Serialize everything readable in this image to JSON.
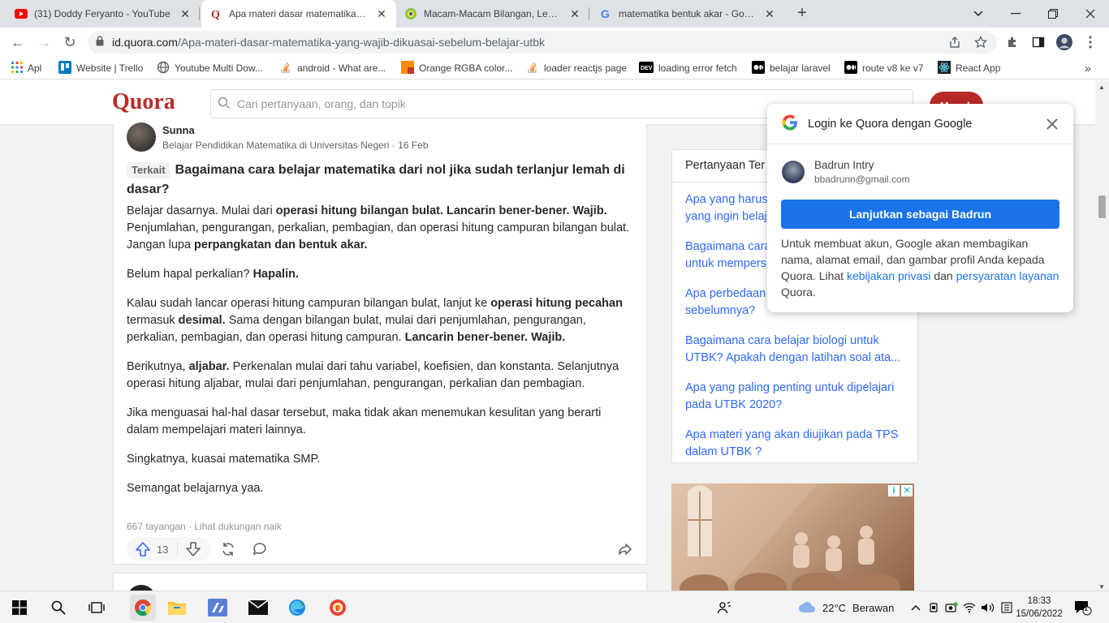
{
  "tabs": [
    {
      "title": "(31) Doddy Feryanto - YouTube",
      "icon": "youtube-icon"
    },
    {
      "title": "Apa materi dasar matematika yang wajib dikuasai",
      "icon": "quora-icon"
    },
    {
      "title": "Macam-Macam Bilangan, Lengkap",
      "icon": "site-icon"
    },
    {
      "title": "matematika bentuk akar - Google",
      "icon": "google-icon"
    }
  ],
  "omnibox": {
    "host": "id.quora.com",
    "path": "/Apa-materi-dasar-matematika-yang-wajib-dikuasai-sebelum-belajar-utbk"
  },
  "bookmarks": [
    {
      "label": "Apl",
      "icon": "apps-grid-icon"
    },
    {
      "label": "Website | Trello",
      "icon": "trello-icon"
    },
    {
      "label": "Youtube Multi Dow...",
      "icon": "globe-icon"
    },
    {
      "label": "android - What are...",
      "icon": "stackoverflow-icon"
    },
    {
      "label": "Orange RGBA color...",
      "icon": "color-icon"
    },
    {
      "label": "loader reactjs page",
      "icon": "stackoverflow-icon"
    },
    {
      "label": "loading error fetch",
      "icon": "dev-icon"
    },
    {
      "label": "belajar laravel",
      "icon": "medium-icon"
    },
    {
      "label": "route v8 ke v7",
      "icon": "medium-icon"
    },
    {
      "label": "React App",
      "icon": "react-icon"
    }
  ],
  "quora": {
    "logo": "Quora",
    "search_placeholder": "Cari pertanyaan, orang, dan topik",
    "signin_label": "Masuk"
  },
  "answer": {
    "author": "Sunna",
    "credential": "Belajar Pendidikan Matematika di Universitas Negeri · 16 Feb",
    "related_tag": "Terkait",
    "related_question": "Bagaimana cara belajar matematika dari nol jika sudah terlanjur lemah di dasar?",
    "views": "667 tayangan · Lihat dukungan naik",
    "upvotes": "13"
  },
  "answer_paragraphs": [
    [
      {
        "t": "Belajar dasarnya. Mulai dari "
      },
      {
        "t": "operasi hitung bilangan bulat. Lancarin bener-bener. Wajib.",
        "b": true
      },
      {
        "t": " Penjumlahan, pengurangan, perkalian, pembagian, dan operasi hitung campuran bilangan bulat. Jangan lupa "
      },
      {
        "t": "perpangkatan dan bentuk akar.",
        "b": true
      }
    ],
    [
      {
        "t": "Belum hapal perkalian? "
      },
      {
        "t": "Hapalin.",
        "b": true
      }
    ],
    [
      {
        "t": "Kalau sudah lancar operasi hitung campuran bilangan bulat, lanjut ke "
      },
      {
        "t": "operasi hitung pecahan",
        "b": true
      },
      {
        "t": " termasuk "
      },
      {
        "t": "desimal.",
        "b": true
      },
      {
        "t": " Sama dengan bilangan bulat, mulai dari penjumlahan, pengurangan, perkalian, pembagian, dan operasi hitung campuran. "
      },
      {
        "t": "Lancarin bener-bener. Wajib.",
        "b": true
      }
    ],
    [
      {
        "t": "Berikutnya, "
      },
      {
        "t": "aljabar.",
        "b": true
      },
      {
        "t": " Perkenalan mulai dari tahu variabel, koefisien, dan konstanta. Selanjutnya operasi hitung aljabar, mulai dari penjumlahan, pengurangan, perkalian dan pembagian."
      }
    ],
    [
      {
        "t": "Jika menguasai hal-hal dasar tersebut, maka tidak akan menemukan kesulitan yang berarti dalam mempelajari materi lainnya."
      }
    ],
    [
      {
        "t": "Singkatnya, kuasai matematika SMP."
      }
    ],
    [
      {
        "t": "Semangat belajarnya yaa."
      }
    ]
  ],
  "related": {
    "heading": "Pertanyaan Ter",
    "questions": [
      "Apa yang harus... yang ingin belaj...",
      "Bagaimana cara... untuk mempers...",
      "Apa perbedaan... sebelumnya?",
      "Bagaimana cara belajar biologi untuk UTBK? Apakah dengan latihan soal ata...",
      "Apa yang paling penting untuk dipelajari pada UTBK 2020?",
      "Apa materi yang akan diujikan pada TPS dalam UTBK ?"
    ],
    "questions_visible": [
      [
        "Apa yang harus",
        "yang ingin belaj"
      ],
      [
        "Bagaimana cara",
        "untuk mempers"
      ],
      [
        "Apa perbedaan",
        "sebelumnya?"
      ],
      [
        "Bagaimana cara belajar biologi untuk",
        "UTBK? Apakah dengan latihan soal ata..."
      ],
      [
        "Apa yang paling penting untuk dipelajari",
        "pada UTBK 2020?"
      ],
      [
        "Apa materi yang akan diujikan pada TPS",
        "dalam UTBK ?"
      ]
    ]
  },
  "google_onetap": {
    "title": "Login ke Quora dengan Google",
    "account_name": "Badrun Intry",
    "account_email": "bbadrunn@gmail.com",
    "continue_label": "Lanjutkan sebagai Badrun",
    "consent_prefix": "Untuk membuat akun, Google akan membagikan nama, alamat email, dan gambar profil Anda kepada Quora. Lihat ",
    "privacy_link": "kebijakan privasi",
    "consent_mid": " dan ",
    "terms_link": "persyaratan layanan",
    "consent_suffix": " Quora."
  },
  "taskbar": {
    "weather_temp": "22°C",
    "weather_desc": "Berawan",
    "time": "18:33",
    "date": "15/06/2022",
    "notification_count": "1"
  },
  "colors": {
    "quora_red": "#b92b27",
    "link_blue": "#2e69ff",
    "google_blue": "#1a73e8"
  }
}
